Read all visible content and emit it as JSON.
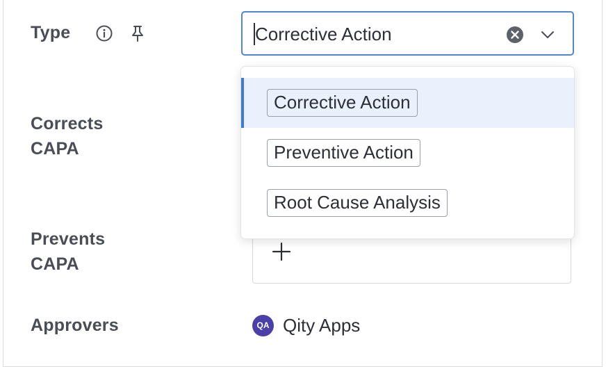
{
  "fields": {
    "type": {
      "label": "Type",
      "info_icon": "info-circle-icon",
      "pin_icon": "pin-icon",
      "value": "Corrective Action",
      "clear_icon": "clear-x-icon",
      "chevron_icon": "chevron-down-icon"
    },
    "corrects_capa": {
      "label": "Corrects CAPA"
    },
    "prevents_capa": {
      "label": "Prevents CAPA",
      "add_icon": "plus-icon"
    },
    "approvers": {
      "label": "Approvers",
      "items": [
        {
          "initials": "QA",
          "name": "Qity Apps",
          "avatar_color": "#4b3fa8"
        }
      ]
    }
  },
  "dropdown": {
    "options": [
      {
        "label": "Corrective Action",
        "selected": true
      },
      {
        "label": "Preventive Action",
        "selected": false
      },
      {
        "label": "Root Cause Analysis",
        "selected": false
      }
    ]
  },
  "colors": {
    "focus_border": "#4f86d1",
    "selected_bg": "#eaf1fd",
    "selected_bar": "#3f7bd0",
    "label_text": "#4a4d55"
  }
}
